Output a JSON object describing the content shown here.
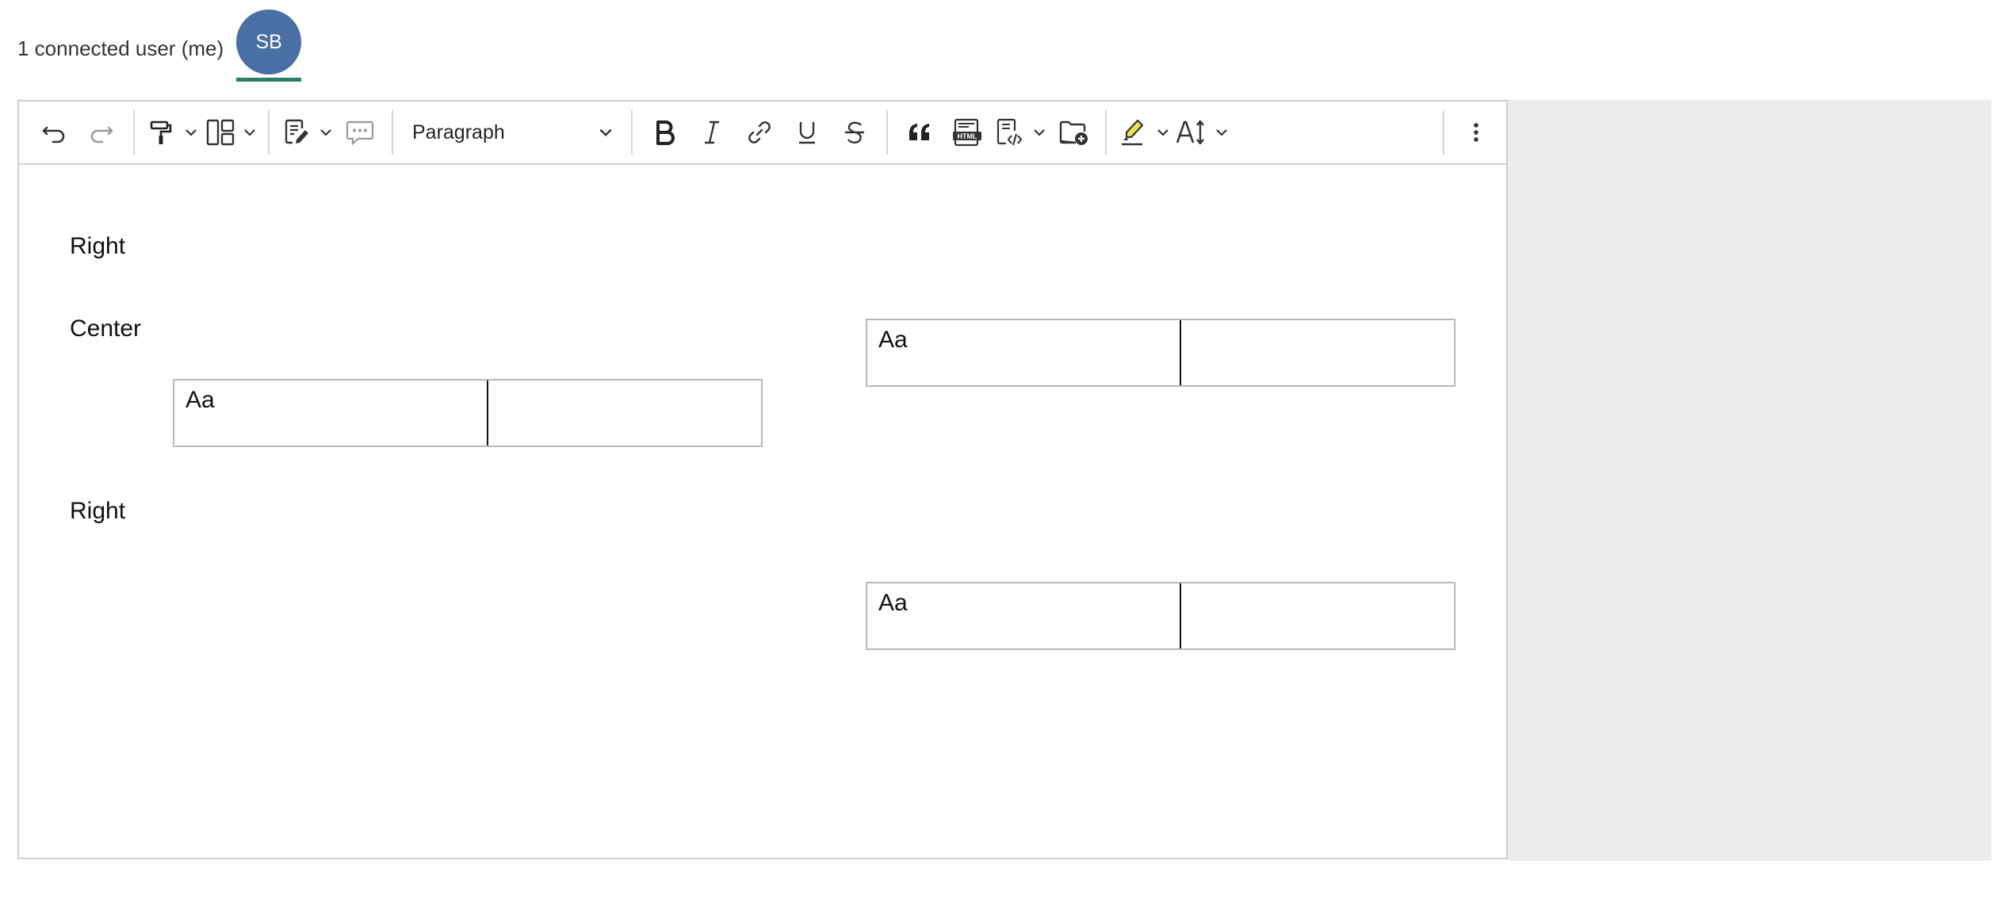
{
  "presence": {
    "label": "1 connected user (me)",
    "avatar_initials": "SB",
    "avatar_color": "#4a6fa5",
    "underline_color": "#2e7d6b"
  },
  "toolbar": {
    "items": [
      "undo",
      "redo",
      "format-painter",
      "layout",
      "template",
      "comment",
      "block-type",
      "bold",
      "italic",
      "link",
      "underline",
      "strikethrough",
      "blockquote",
      "html-embed",
      "source-code",
      "insert-file",
      "highlight",
      "font-size",
      "more"
    ],
    "block_type_value": "Paragraph"
  },
  "content": {
    "paragraph_1": "Right",
    "paragraph_2": "Center",
    "paragraph_3": "Right",
    "table_right_top": {
      "cells": [
        "Aa",
        ""
      ]
    },
    "table_center": {
      "cells": [
        "Aa",
        ""
      ]
    },
    "table_right_bottom": {
      "cells": [
        "Aa",
        ""
      ]
    }
  },
  "colors": {
    "editor_border": "#cfcfcf",
    "side_panel": "#ececec",
    "icon": "#333333",
    "icon_disabled": "#9a9a9a"
  }
}
